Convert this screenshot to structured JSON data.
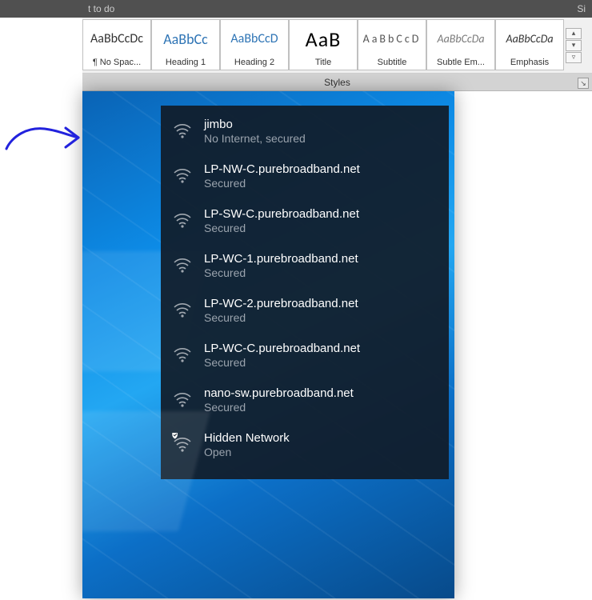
{
  "titlebar": {
    "left": "t to do",
    "right": "Si"
  },
  "ribbon": {
    "styles": [
      {
        "preview": "AaBbCcDc",
        "label": "¶ No Spac...",
        "pclass": "p0"
      },
      {
        "preview": "AaBbCc",
        "label": "Heading 1",
        "pclass": "p1"
      },
      {
        "preview": "AaBbCcD",
        "label": "Heading 2",
        "pclass": "p2"
      },
      {
        "preview": "AaB",
        "label": "Title",
        "pclass": "p3"
      },
      {
        "preview": "AaBbCcD",
        "label": "Subtitle",
        "pclass": "p4"
      },
      {
        "preview": "AaBbCcDa",
        "label": "Subtle Em...",
        "pclass": "p5"
      },
      {
        "preview": "AaBbCcDa",
        "label": "Emphasis",
        "pclass": "p6"
      }
    ],
    "group_label": "Styles"
  },
  "wifi": {
    "networks": [
      {
        "name": "jimbo",
        "status": "No Internet, secured",
        "icon": "wifi",
        "shield": false
      },
      {
        "name": "LP-NW-C.purebroadband.net",
        "status": "Secured",
        "icon": "wifi",
        "shield": false
      },
      {
        "name": "LP-SW-C.purebroadband.net",
        "status": "Secured",
        "icon": "wifi",
        "shield": false
      },
      {
        "name": "LP-WC-1.purebroadband.net",
        "status": "Secured",
        "icon": "wifi",
        "shield": false
      },
      {
        "name": "LP-WC-2.purebroadband.net",
        "status": "Secured",
        "icon": "wifi",
        "shield": false
      },
      {
        "name": "LP-WC-C.purebroadband.net",
        "status": "Secured",
        "icon": "wifi",
        "shield": false
      },
      {
        "name": "nano-sw.purebroadband.net",
        "status": "Secured",
        "icon": "wifi",
        "shield": false
      },
      {
        "name": "Hidden Network",
        "status": "Open",
        "icon": "wifi",
        "shield": true
      }
    ]
  },
  "annotation": {
    "type": "hand-drawn-arrow",
    "color": "#2222dd"
  }
}
